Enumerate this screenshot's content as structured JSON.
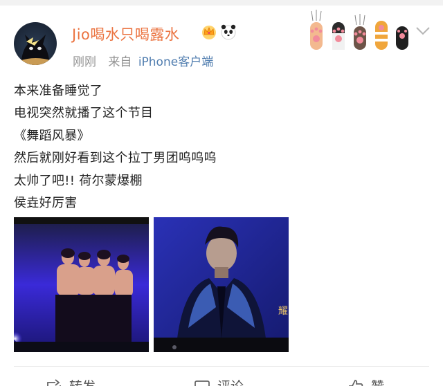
{
  "post": {
    "author": {
      "name": "Jio喝水只喝露水",
      "badges": [
        "crown-icon",
        "panda-icon"
      ]
    },
    "time": "刚刚",
    "source_label": "来自",
    "source": "iPhone客户端",
    "text_lines": [
      "本来准备睡觉了",
      "电视突然就播了这个节目",
      "《舞蹈风暴》",
      "然后就刚好看到这个拉丁男团呜呜呜",
      "太帅了吧!! 荷尔蒙爆棚",
      "侯垚好厉害"
    ],
    "images": [
      {
        "description_icon": "tv-stage-dancers-photo"
      },
      {
        "description_icon": "tv-singer-closeup-photo"
      }
    ]
  },
  "actions": {
    "repost_label": "转发",
    "comment_label": "评论",
    "like_label": "赞"
  },
  "colors": {
    "username": "#eb7340",
    "source_link": "#507daf",
    "meta": "#939393",
    "text": "#222222"
  }
}
